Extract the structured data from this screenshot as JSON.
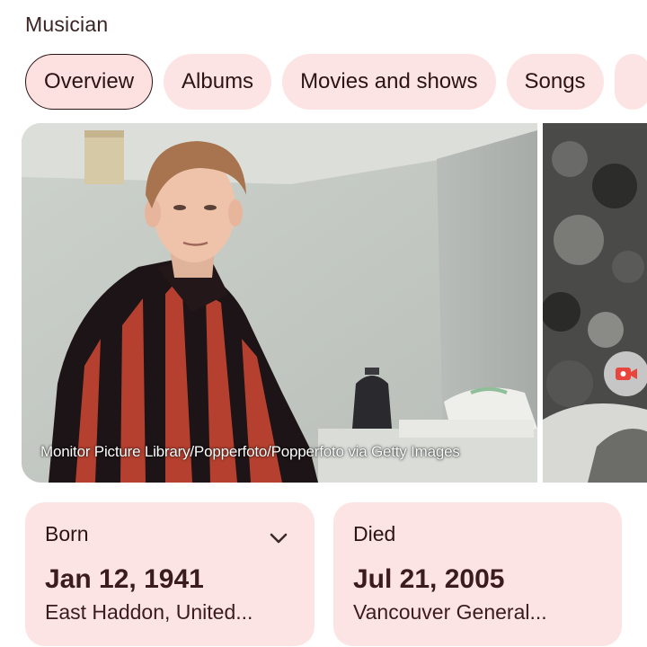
{
  "header": {
    "subtitle": "Musician"
  },
  "tabs": [
    {
      "label": "Overview",
      "active": true
    },
    {
      "label": "Albums",
      "active": false
    },
    {
      "label": "Movies and shows",
      "active": false
    },
    {
      "label": "Songs",
      "active": false
    }
  ],
  "photos": {
    "main_credit": "Monitor Picture Library/Popperfoto/Popperfoto via Getty Images",
    "camera_icon": "camera-icon"
  },
  "facts": {
    "born": {
      "label": "Born",
      "date": "Jan 12, 1941",
      "place": "East Haddon, United...",
      "expand_icon": "chevron-down-icon"
    },
    "died": {
      "label": "Died",
      "date": "Jul 21, 2005",
      "place": "Vancouver General..."
    }
  },
  "colors": {
    "chip_background": "#fde4e4",
    "card_background": "#fde4e4",
    "text": "#2b1414",
    "camera_accent": "#e8453c"
  }
}
